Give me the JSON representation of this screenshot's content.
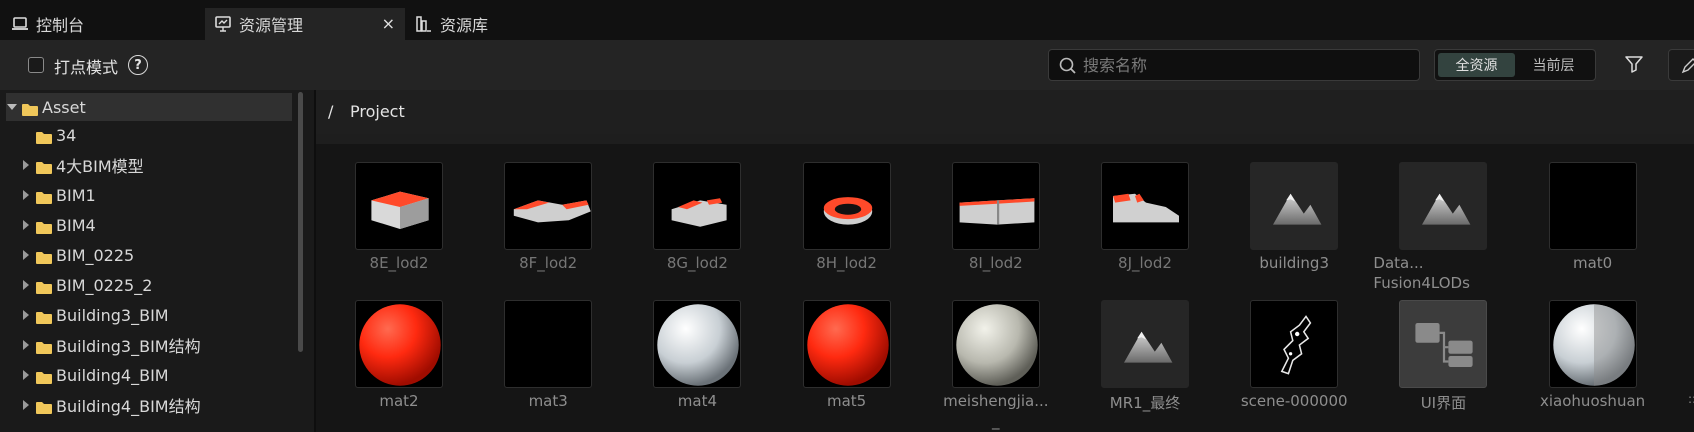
{
  "tabs": [
    {
      "label": "控制台",
      "icon": "laptop-icon"
    },
    {
      "label": "资源管理",
      "icon": "presentation-icon",
      "close": "×"
    },
    {
      "label": "资源库",
      "icon": "library-icon"
    }
  ],
  "toolbar": {
    "checkbox_label": "打点模式",
    "help_label": "?",
    "search_placeholder": "搜索名称",
    "scope_all": "全资源",
    "scope_current": "当前层"
  },
  "tree": {
    "root": "Asset",
    "items": [
      "34",
      "4大BIM模型",
      "BIM1",
      "BIM4",
      "BIM_0225",
      "BIM_0225_2",
      "Building3_BIM",
      "Building3_BIM结构",
      "Building4_BIM",
      "Building4_BIM结构"
    ]
  },
  "breadcrumb": {
    "sep": "/",
    "path": "Project"
  },
  "assets_row1": [
    {
      "name": "8E_lod2",
      "thumb": "model-8e"
    },
    {
      "name": "8F_lod2",
      "thumb": "model-8f"
    },
    {
      "name": "8G_lod2",
      "thumb": "model-8g"
    },
    {
      "name": "8H_lod2",
      "thumb": "model-8h"
    },
    {
      "name": "8I_lod2",
      "thumb": "model-8i"
    },
    {
      "name": "8J_lod2",
      "thumb": "model-8j"
    },
    {
      "name": "building3",
      "thumb": "mountain-icon"
    },
    {
      "name": "Data...",
      "name2": "Fusion4LODs",
      "thumb": "mountain-icon"
    },
    {
      "name": "mat0",
      "thumb": "black"
    }
  ],
  "assets_row2": [
    {
      "name": "mat2",
      "thumb": "red-sphere"
    },
    {
      "name": "mat3",
      "thumb": "black"
    },
    {
      "name": "mat4",
      "thumb": "white-sphere"
    },
    {
      "name": "mat5",
      "thumb": "red-sphere"
    },
    {
      "name": "meishengjia...",
      "name2": "_",
      "thumb": "grey-sphere"
    },
    {
      "name": "MR1_最终",
      "thumb": "mountain-icon"
    },
    {
      "name": "scene-000000",
      "thumb": "scene"
    },
    {
      "name": "UI界面",
      "thumb": "blueprint-icon"
    },
    {
      "name": "xiaohuoshuan",
      "thumb": "split-sphere"
    }
  ],
  "scroll_hint": "::"
}
